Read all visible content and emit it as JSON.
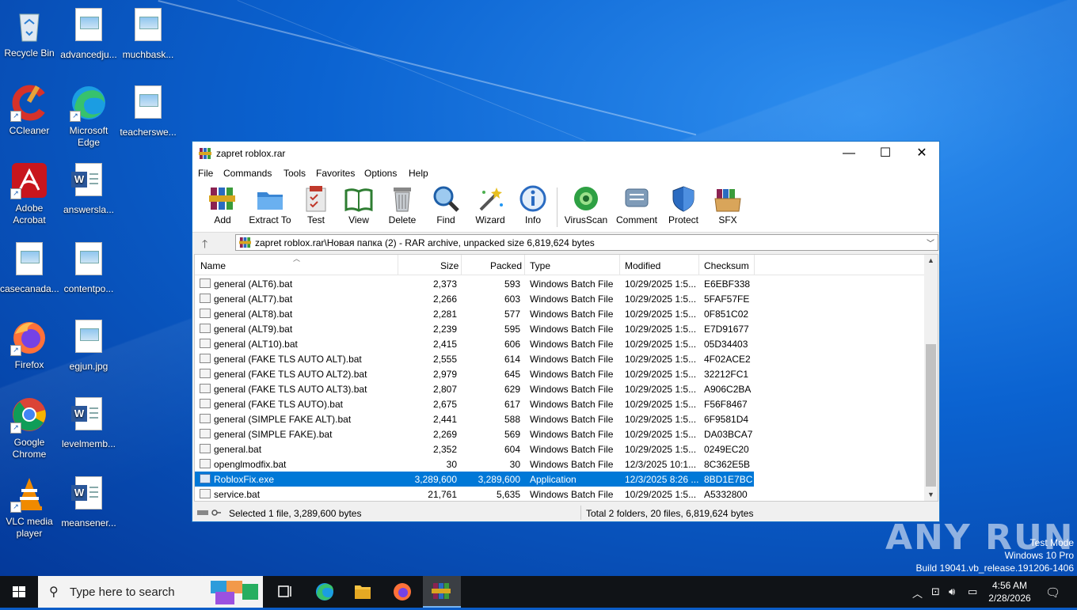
{
  "desktop": {
    "icons": [
      {
        "label": "Recycle Bin",
        "icon": "recycle-bin-icon"
      },
      {
        "label": "advancedju...",
        "icon": "image-file-icon"
      },
      {
        "label": "muchbask...",
        "icon": "image-file-icon"
      },
      {
        "label": "CCleaner",
        "icon": "ccleaner-icon"
      },
      {
        "label": "Microsoft Edge",
        "icon": "edge-icon"
      },
      {
        "label": "teacherswe...",
        "icon": "image-file-icon"
      },
      {
        "label": "Adobe Acrobat",
        "icon": "acrobat-icon"
      },
      {
        "label": "answersla...",
        "icon": "word-doc-icon"
      },
      {
        "label": "casecanada...",
        "icon": "image-file-icon"
      },
      {
        "label": "contentpo...",
        "icon": "image-file-icon"
      },
      {
        "label": "Firefox",
        "icon": "firefox-icon"
      },
      {
        "label": "egjun.jpg",
        "icon": "image-file-icon"
      },
      {
        "label": "Google Chrome",
        "icon": "chrome-icon"
      },
      {
        "label": "levelmemb...",
        "icon": "word-doc-icon"
      },
      {
        "label": "VLC media player",
        "icon": "vlc-icon"
      },
      {
        "label": "meansener...",
        "icon": "word-doc-icon"
      }
    ]
  },
  "window": {
    "title": "zapret roblox.rar",
    "menu": [
      "File",
      "Commands",
      "Tools",
      "Favorites",
      "Options",
      "Help"
    ],
    "toolbar": [
      "Add",
      "Extract To",
      "Test",
      "View",
      "Delete",
      "Find",
      "Wizard",
      "Info",
      "VirusScan",
      "Comment",
      "Protect",
      "SFX"
    ],
    "address": "zapret roblox.rar\\Новая папка (2) - RAR archive, unpacked size 6,819,624 bytes",
    "columns": [
      "Name",
      "Size",
      "Packed",
      "Type",
      "Modified",
      "Checksum"
    ],
    "files": [
      {
        "name": "general (ALT6).bat",
        "size": "2,373",
        "packed": "593",
        "type": "Windows Batch File",
        "modified": "10/29/2025 1:5...",
        "checksum": "E6EBF338"
      },
      {
        "name": "general (ALT7).bat",
        "size": "2,266",
        "packed": "603",
        "type": "Windows Batch File",
        "modified": "10/29/2025 1:5...",
        "checksum": "5FAF57FE"
      },
      {
        "name": "general (ALT8).bat",
        "size": "2,281",
        "packed": "577",
        "type": "Windows Batch File",
        "modified": "10/29/2025 1:5...",
        "checksum": "0F851C02"
      },
      {
        "name": "general (ALT9).bat",
        "size": "2,239",
        "packed": "595",
        "type": "Windows Batch File",
        "modified": "10/29/2025 1:5...",
        "checksum": "E7D91677"
      },
      {
        "name": "general (ALT10).bat",
        "size": "2,415",
        "packed": "606",
        "type": "Windows Batch File",
        "modified": "10/29/2025 1:5...",
        "checksum": "05D34403"
      },
      {
        "name": "general (FAKE TLS AUTO ALT).bat",
        "size": "2,555",
        "packed": "614",
        "type": "Windows Batch File",
        "modified": "10/29/2025 1:5...",
        "checksum": "4F02ACE2"
      },
      {
        "name": "general (FAKE TLS AUTO ALT2).bat",
        "size": "2,979",
        "packed": "645",
        "type": "Windows Batch File",
        "modified": "10/29/2025 1:5...",
        "checksum": "32212FC1"
      },
      {
        "name": "general (FAKE TLS AUTO ALT3).bat",
        "size": "2,807",
        "packed": "629",
        "type": "Windows Batch File",
        "modified": "10/29/2025 1:5...",
        "checksum": "A906C2BA"
      },
      {
        "name": "general (FAKE TLS AUTO).bat",
        "size": "2,675",
        "packed": "617",
        "type": "Windows Batch File",
        "modified": "10/29/2025 1:5...",
        "checksum": "F56F8467"
      },
      {
        "name": "general (SIMPLE FAKE ALT).bat",
        "size": "2,441",
        "packed": "588",
        "type": "Windows Batch File",
        "modified": "10/29/2025 1:5...",
        "checksum": "6F9581D4"
      },
      {
        "name": "general (SIMPLE FAKE).bat",
        "size": "2,269",
        "packed": "569",
        "type": "Windows Batch File",
        "modified": "10/29/2025 1:5...",
        "checksum": "DA03BCA7"
      },
      {
        "name": "general.bat",
        "size": "2,352",
        "packed": "604",
        "type": "Windows Batch File",
        "modified": "10/29/2025 1:5...",
        "checksum": "0249EC20"
      },
      {
        "name": "openglmodfix.bat",
        "size": "30",
        "packed": "30",
        "type": "Windows Batch File",
        "modified": "12/3/2025 10:1...",
        "checksum": "8C362E5B"
      },
      {
        "name": "RobloxFix.exe",
        "size": "3,289,600",
        "packed": "3,289,600",
        "type": "Application",
        "modified": "12/3/2025 8:26 ...",
        "checksum": "8BD1E7BC",
        "selected": true
      },
      {
        "name": "service.bat",
        "size": "21,761",
        "packed": "5,635",
        "type": "Windows Batch File",
        "modified": "10/29/2025 1:5...",
        "checksum": "A5332800"
      }
    ],
    "status_left": "Selected 1 file, 3,289,600 bytes",
    "status_right": "Total 2 folders, 20 files, 6,819,624 bytes"
  },
  "watermark": {
    "brand": "ANY RUN",
    "line1": "Test Mode",
    "line2": "Windows 10 Pro",
    "line3": "Build 19041.vb_release.191206-1406"
  },
  "taskbar": {
    "search_placeholder": "Type here to search",
    "time": "4:56 AM",
    "date": "2/28/2026"
  },
  "colors": {
    "accent": "#0078d7",
    "taskbar": "#101317"
  }
}
